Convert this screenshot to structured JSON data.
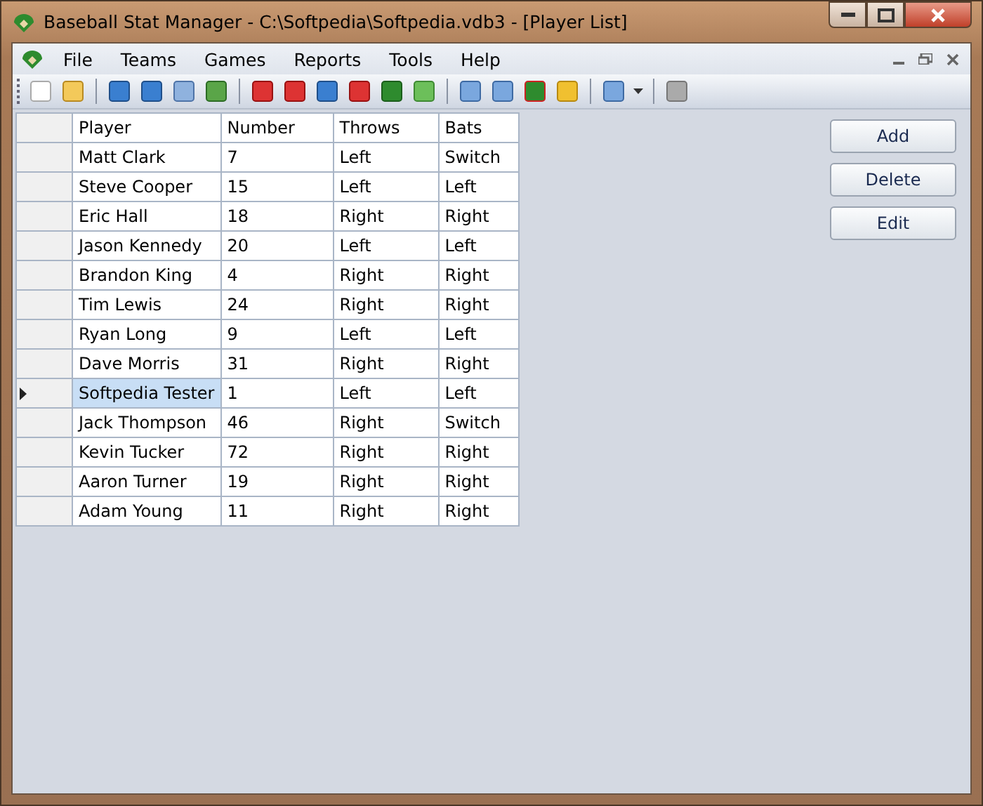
{
  "window": {
    "title": "Baseball Stat Manager - C:\\Softpedia\\Softpedia.vdb3 - [Player List]"
  },
  "menu": [
    "File",
    "Teams",
    "Games",
    "Reports",
    "Tools",
    "Help"
  ],
  "table": {
    "columns": [
      "Player",
      "Number",
      "Throws",
      "Bats"
    ],
    "rows": [
      {
        "cells": [
          "Matt Clark",
          "7",
          "Left",
          "Switch"
        ],
        "selected": false
      },
      {
        "cells": [
          "Steve Cooper",
          "15",
          "Left",
          "Left"
        ],
        "selected": false
      },
      {
        "cells": [
          "Eric Hall",
          "18",
          "Right",
          "Right"
        ],
        "selected": false
      },
      {
        "cells": [
          "Jason Kennedy",
          "20",
          "Left",
          "Left"
        ],
        "selected": false
      },
      {
        "cells": [
          "Brandon King",
          "4",
          "Right",
          "Right"
        ],
        "selected": false
      },
      {
        "cells": [
          "Tim Lewis",
          "24",
          "Right",
          "Right"
        ],
        "selected": false
      },
      {
        "cells": [
          "Ryan Long",
          "9",
          "Left",
          "Left"
        ],
        "selected": false
      },
      {
        "cells": [
          "Dave Morris",
          "31",
          "Right",
          "Right"
        ],
        "selected": false
      },
      {
        "cells": [
          "Softpedia Tester",
          "1",
          "Left",
          "Left"
        ],
        "selected": true
      },
      {
        "cells": [
          "Jack Thompson",
          "46",
          "Right",
          "Switch"
        ],
        "selected": false
      },
      {
        "cells": [
          "Kevin Tucker",
          "72",
          "Right",
          "Right"
        ],
        "selected": false
      },
      {
        "cells": [
          "Aaron Turner",
          "19",
          "Right",
          "Right"
        ],
        "selected": false
      },
      {
        "cells": [
          "Adam Young",
          "11",
          "Right",
          "Right"
        ],
        "selected": false
      }
    ]
  },
  "buttons": [
    "Add",
    "Delete",
    "Edit"
  ]
}
